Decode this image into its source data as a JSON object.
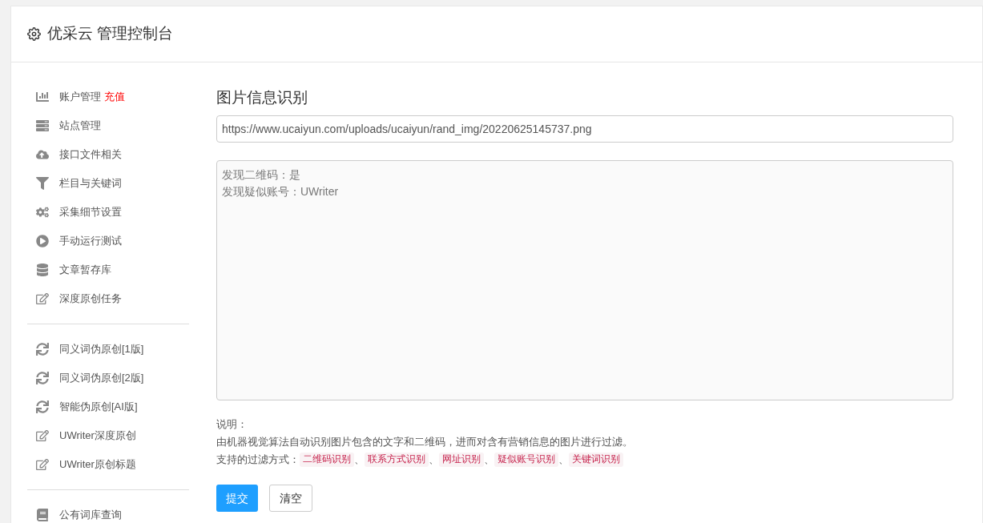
{
  "header": {
    "title": "优采云 管理控制台"
  },
  "sidebar": {
    "sections": [
      [
        {
          "label": "账户管理",
          "badge": "充值",
          "kind": "chart"
        },
        {
          "label": "站点管理",
          "kind": "server"
        },
        {
          "label": "接口文件相关",
          "kind": "cloud"
        },
        {
          "label": "栏目与关键词",
          "kind": "filter"
        },
        {
          "label": "采集细节设置",
          "kind": "cogs"
        },
        {
          "label": "手动运行测试",
          "kind": "play"
        },
        {
          "label": "文章暂存库",
          "kind": "database"
        },
        {
          "label": "深度原创任务",
          "kind": "edit"
        }
      ],
      [
        {
          "label": "同义词伪原创[1版]",
          "kind": "refresh"
        },
        {
          "label": "同义词伪原创[2版]",
          "kind": "refresh"
        },
        {
          "label": "智能伪原创[AI版]",
          "kind": "refresh"
        },
        {
          "label": "UWriter深度原创",
          "kind": "edit"
        },
        {
          "label": "UWriter原创标题",
          "kind": "edit"
        }
      ],
      [
        {
          "label": "公有词库查询",
          "kind": "book"
        }
      ]
    ]
  },
  "main": {
    "title": "图片信息识别",
    "url_field": {
      "value": "https://www.ucaiyun.com/uploads/ucaiyun/rand_img/20220625145737.png"
    },
    "result_lines": [
      "发现二维码：是",
      "发现疑似账号：UWriter"
    ],
    "note_label": "说明：",
    "note_text": "由机器视觉算法自动识别图片包含的文字和二维码，进而对含有营销信息的图片进行过滤。",
    "filter_label": "支持的过滤方式：",
    "filter_separator": "、",
    "filter_methods": [
      "二维码识别",
      "联系方式识别",
      "网址识别",
      "疑似账号识别",
      "关键词识别"
    ],
    "buttons": [
      {
        "label": "提交",
        "kind": "primary"
      },
      {
        "label": "清空",
        "kind": "default"
      }
    ]
  }
}
